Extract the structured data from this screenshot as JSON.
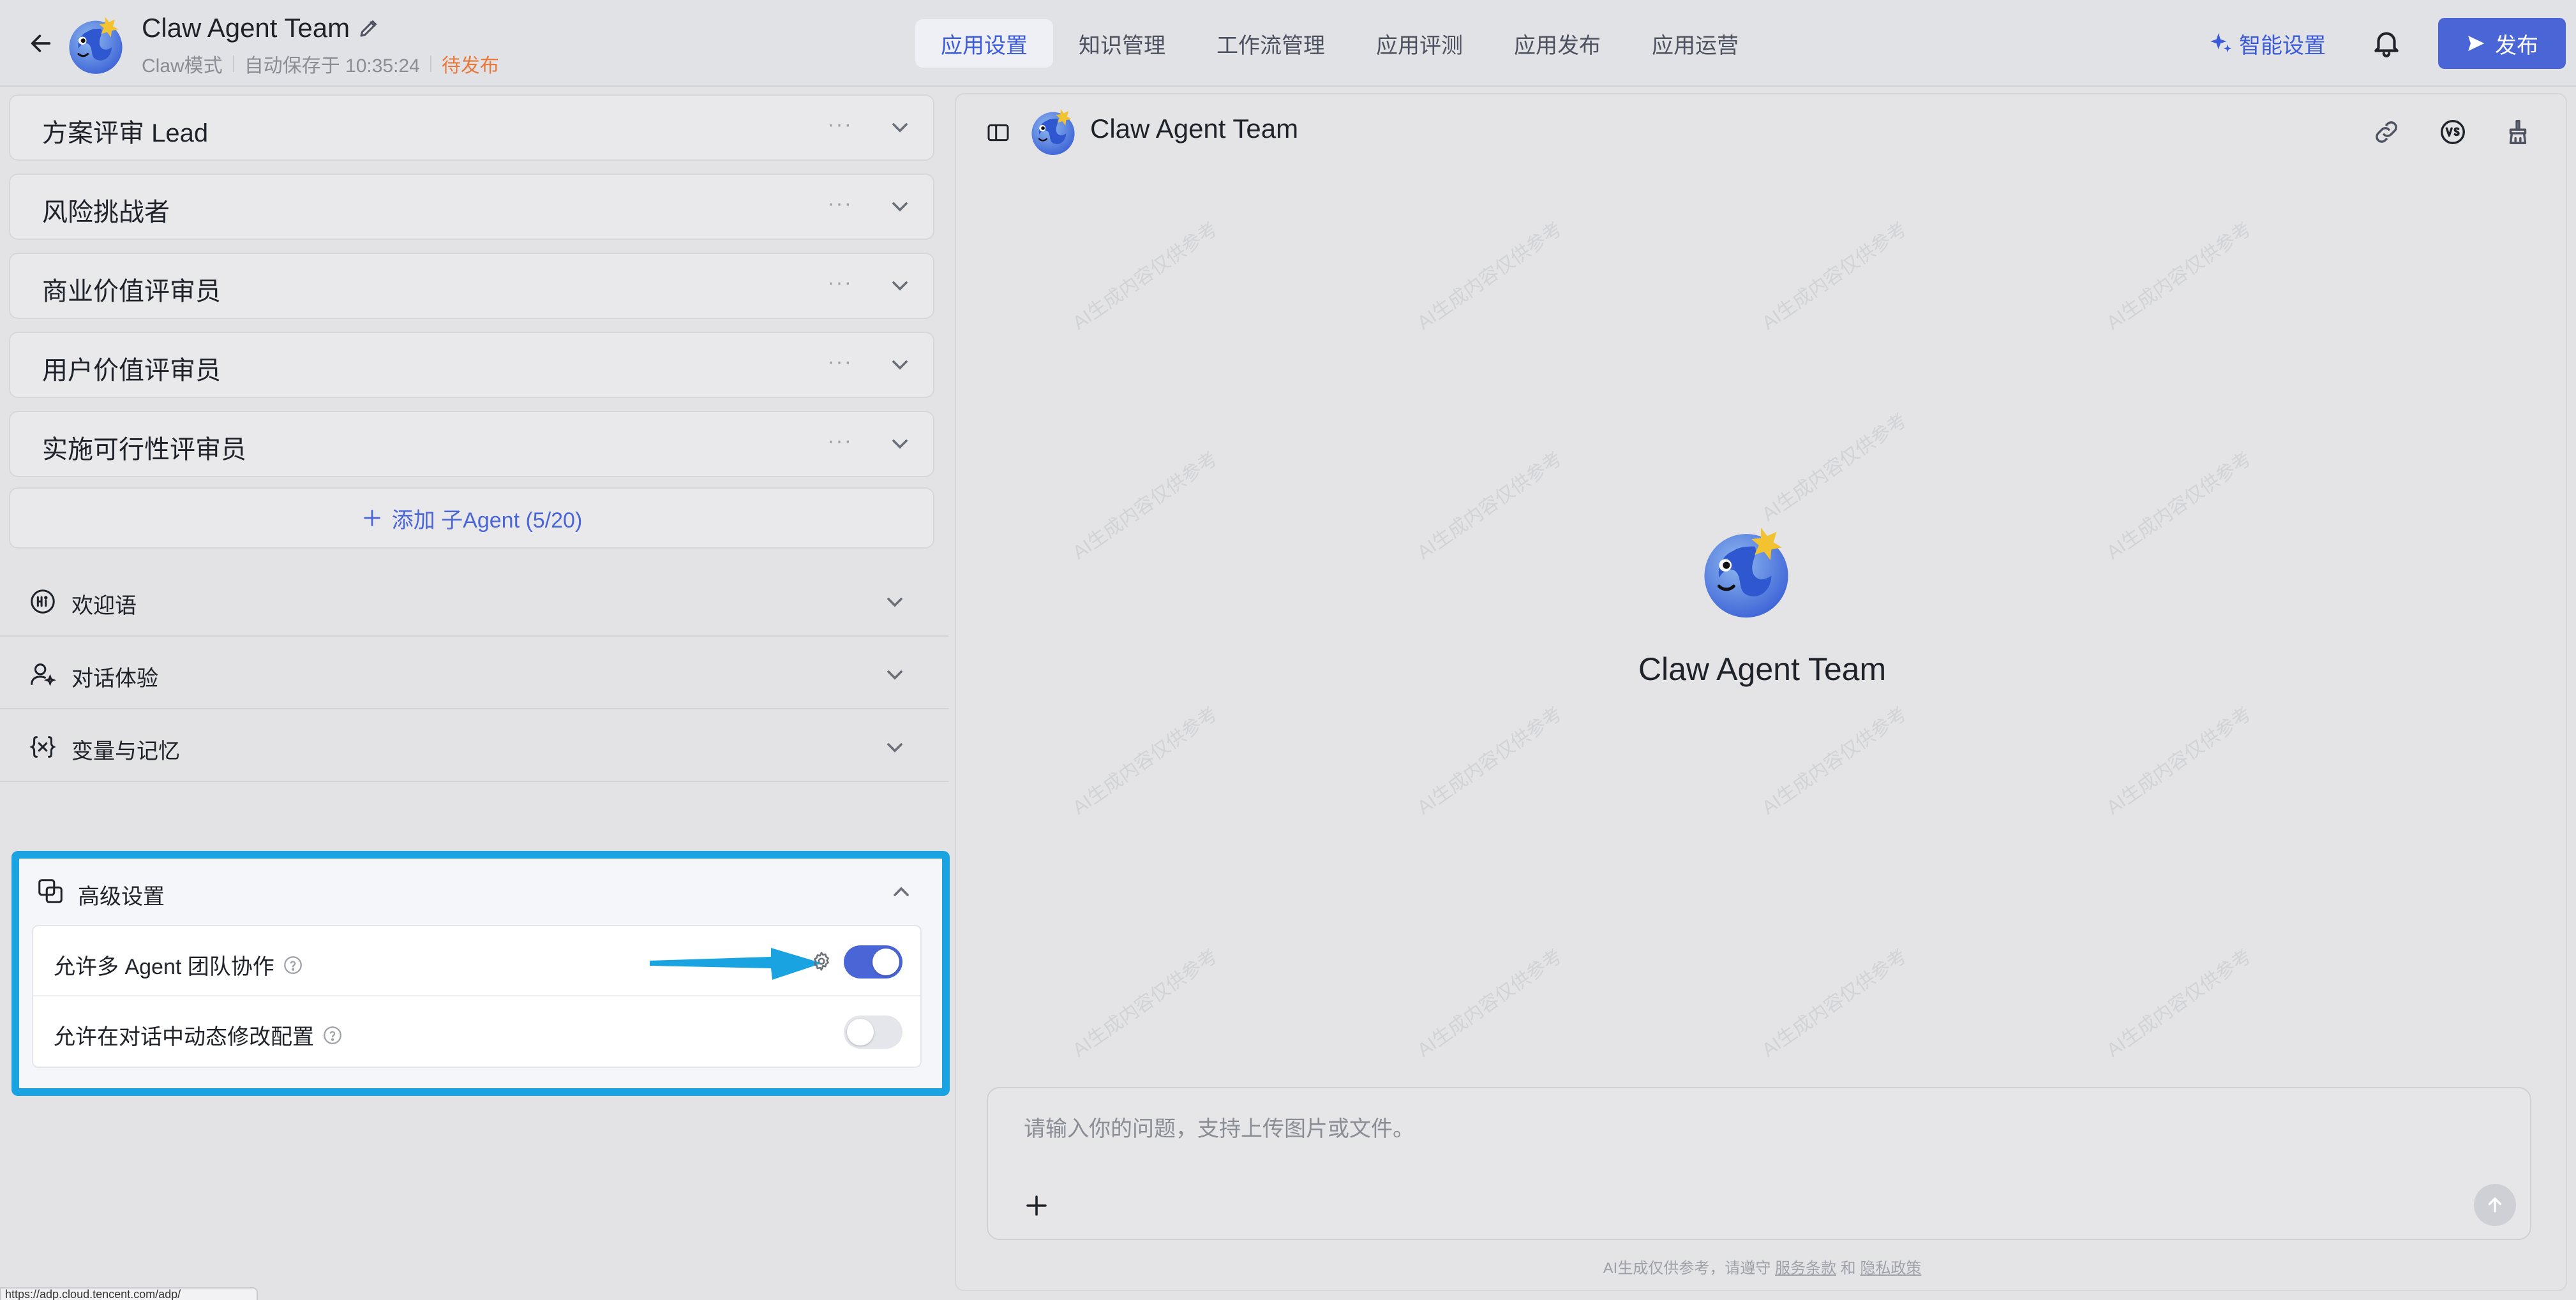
{
  "header": {
    "app_name": "Claw Agent Team",
    "mode": "Claw模式",
    "autosave": "自动保存于 10:35:24",
    "status": "待发布",
    "tabs": [
      {
        "label": "应用设置",
        "active": true
      },
      {
        "label": "知识管理",
        "active": false
      },
      {
        "label": "工作流管理",
        "active": false
      },
      {
        "label": "应用评测",
        "active": false
      },
      {
        "label": "应用发布",
        "active": false
      },
      {
        "label": "应用运营",
        "active": false
      }
    ],
    "smart_settings": "智能设置",
    "publish": "发布",
    "accent_color": "#4a65d6",
    "status_color": "#e8793a"
  },
  "agents": [
    {
      "name": "方案评审 Lead",
      "more": "···"
    },
    {
      "name": "风险挑战者",
      "more": "···"
    },
    {
      "name": "商业价值评审员",
      "more": "···"
    },
    {
      "name": "用户价值评审员",
      "more": "···"
    },
    {
      "name": "实施可行性评审员",
      "more": "···"
    }
  ],
  "add_agent": "添加 子Agent (5/20)",
  "sections": [
    {
      "label": "欢迎语",
      "icon": "hi-icon"
    },
    {
      "label": "对话体验",
      "icon": "user-sparkle-icon"
    },
    {
      "label": "变量与记忆",
      "icon": "variable-icon"
    }
  ],
  "advanced": {
    "title": "高级设置",
    "highlight_color": "#19a3e1",
    "options": [
      {
        "label": "允许多 Agent 团队协作",
        "enabled": true
      },
      {
        "label": "允许在对话中动态修改配置",
        "enabled": false
      }
    ]
  },
  "chat": {
    "title": "Claw Agent Team",
    "welcome_name": "Claw Agent Team",
    "placeholder": "请输入你的问题，支持上传图片或文件。",
    "footer_prefix": "AI生成仅供参考，请遵守",
    "footer_terms": "服务条款",
    "footer_and": "和",
    "footer_privacy": "隐私政策",
    "watermark": "AI生成内容仅供参考"
  },
  "status_bar_url": "https://adp.cloud.tencent.com/adp/"
}
